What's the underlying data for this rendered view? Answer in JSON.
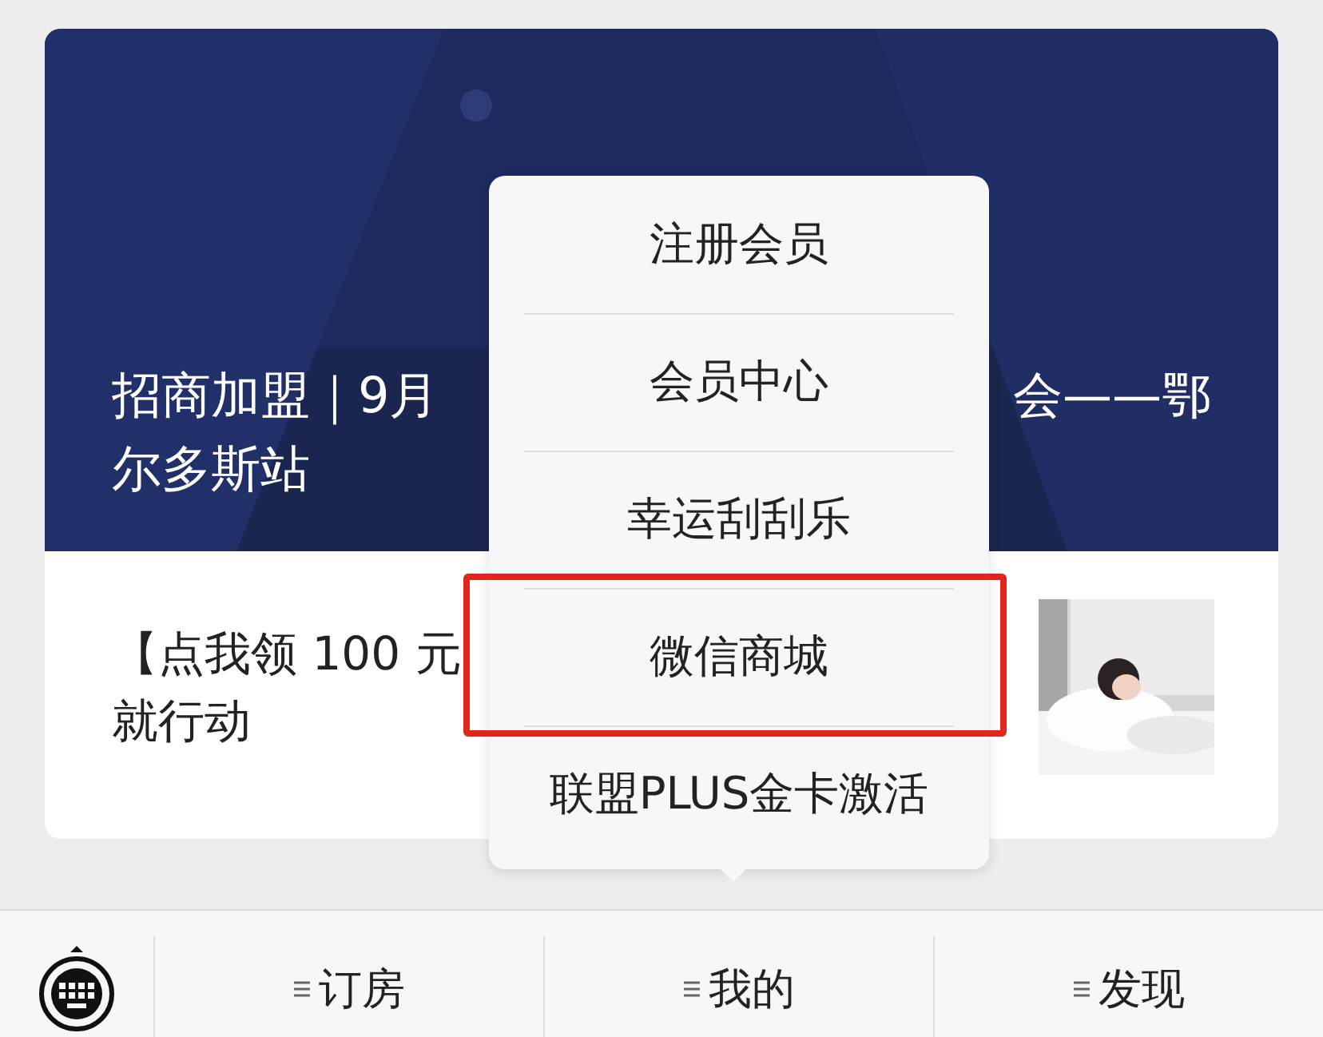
{
  "article": {
    "kind": "picture",
    "title_lines": [
      {
        "left": "招商加盟｜9月",
        "right": "会——鄂"
      },
      {
        "left": "尔多斯站"
      }
    ]
  },
  "promo": {
    "lines": [
      "【点我领 100 元",
      "就行动"
    ],
    "thumbnail": {
      "kind": "picture"
    }
  },
  "menu": {
    "items": [
      {
        "label": "注册会员",
        "highlighted": false
      },
      {
        "label": "会员中心",
        "highlighted": false
      },
      {
        "label": "幸运刮刮乐",
        "highlighted": false
      },
      {
        "label": "微信商城",
        "highlighted": true
      },
      {
        "label": "联盟PLUS金卡激活",
        "highlighted": false
      }
    ]
  },
  "bottom_bar": {
    "tabs": [
      {
        "label": "订房"
      },
      {
        "label": "我的"
      },
      {
        "label": "发现"
      }
    ]
  }
}
